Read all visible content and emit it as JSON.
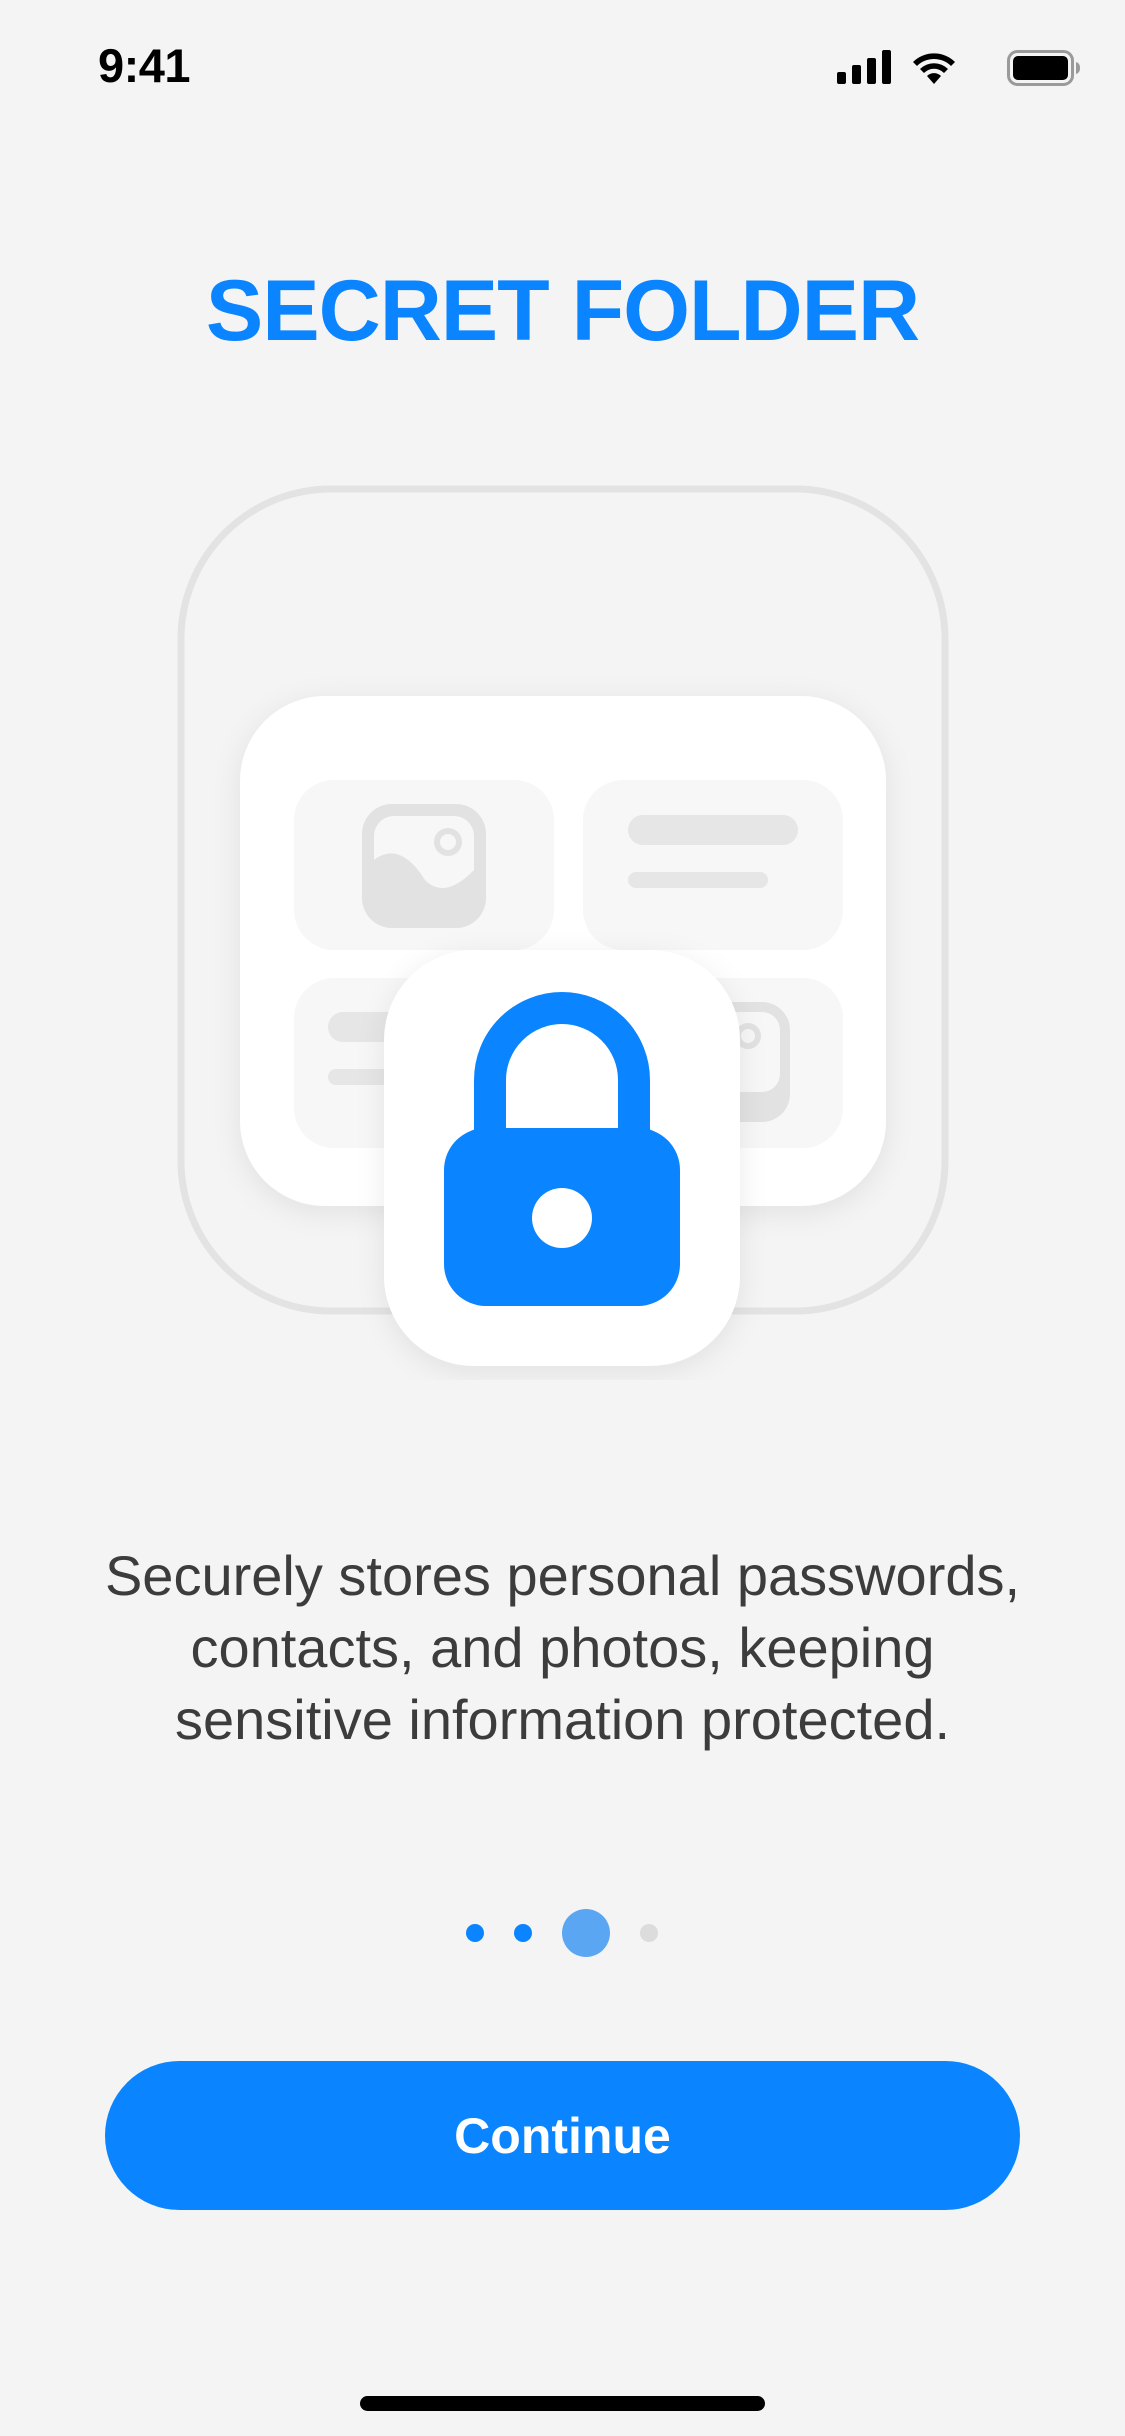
{
  "status_bar": {
    "time": "9:41",
    "icons": [
      "cellular-signal-icon",
      "wifi-icon",
      "battery-icon"
    ]
  },
  "onboarding": {
    "title": "SECRET FOLDER",
    "illustration_icon": "lock-icon",
    "description": "Securely stores personal passwords, contacts, and photos, keeping sensitive information protected.",
    "page_indicator": {
      "total_pages": 4,
      "current_page": 3
    },
    "continue_label": "Continue"
  },
  "colors": {
    "accent": "#0a84ff",
    "background": "#f4f4f4",
    "text": "#3c3c3c",
    "inactive_dot": "#dcdcdc"
  }
}
